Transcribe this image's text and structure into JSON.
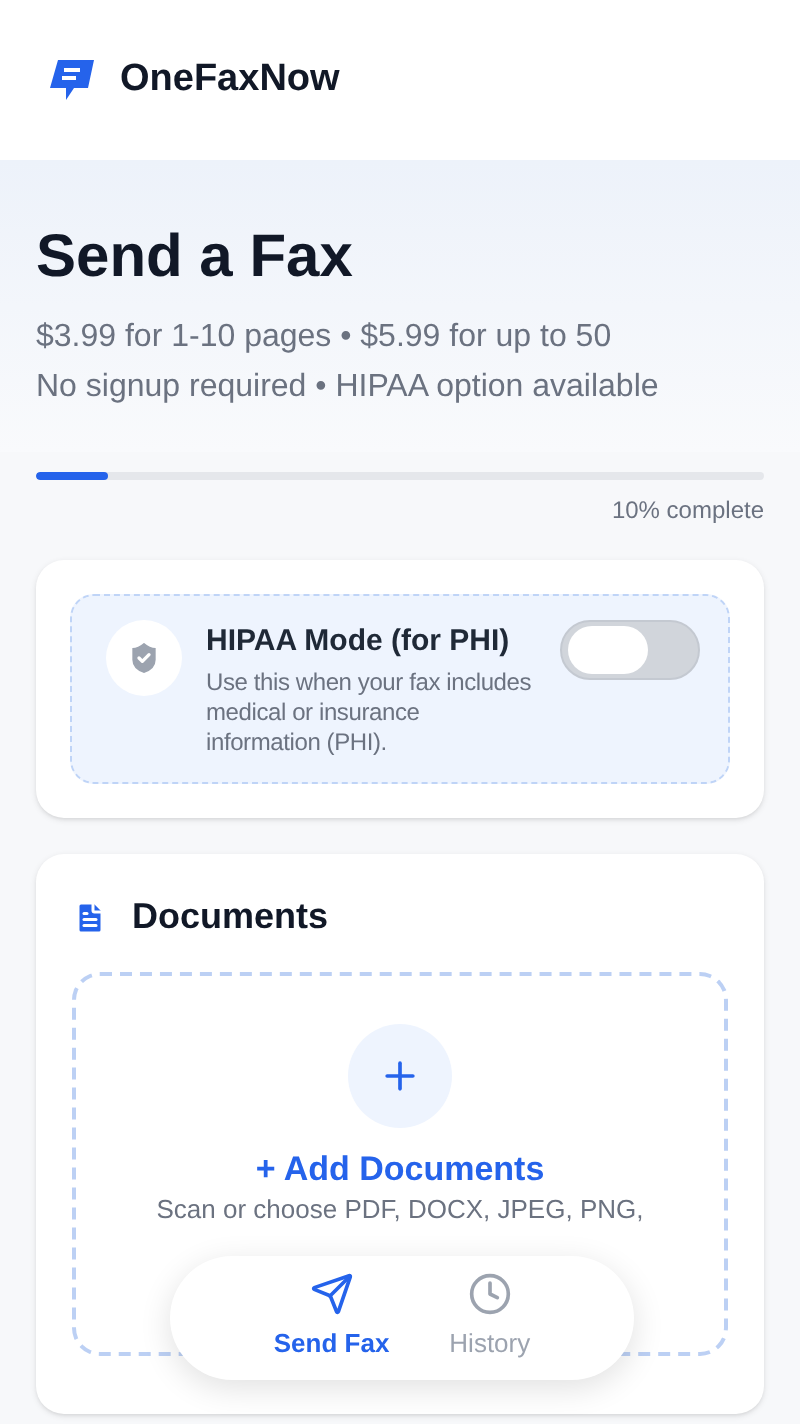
{
  "app": {
    "name": "OneFaxNow"
  },
  "hero": {
    "title": "Send a Fax",
    "lines": [
      "$3.99 for 1-10 pages • $5.99 for up to 50",
      "No signup required • HIPAA option available"
    ]
  },
  "progress": {
    "level": 0.1,
    "label": "10% complete"
  },
  "hipaa": {
    "title": "HIPAA Mode (for PHI)",
    "description": "Use this when your fax includes medical or insurance information (PHI).",
    "on": false
  },
  "documents": {
    "title": "Documents",
    "add_label": "+ Add Documents",
    "hint": "Scan or choose PDF, DOCX, JPEG, PNG,"
  },
  "nav": [
    {
      "label": "Send Fax",
      "kind": "send",
      "selected": true
    },
    {
      "label": "History",
      "kind": "history",
      "selected": false
    }
  ]
}
